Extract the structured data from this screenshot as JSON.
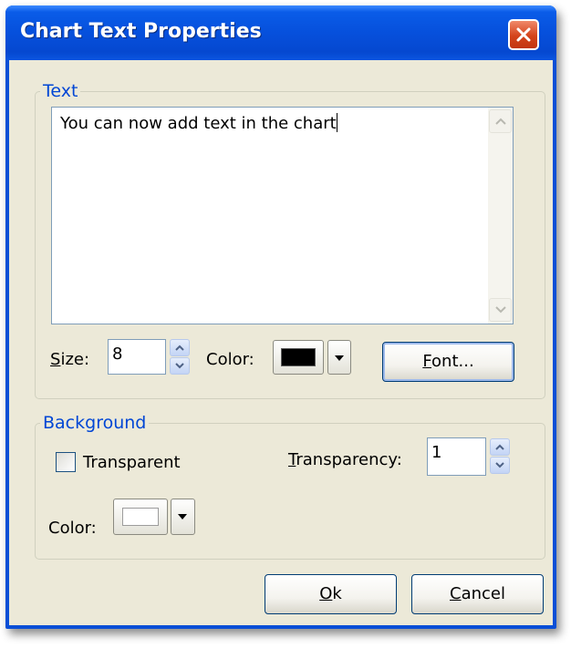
{
  "window": {
    "title": "Chart Text Properties"
  },
  "text_group": {
    "legend": "Text",
    "content": "You can now add text in the chart",
    "size_label_mnemonic": "S",
    "size_label_rest": "ize:",
    "size_value": "8",
    "color_label": "Color:",
    "color_value": "#000000",
    "font_button_mnemonic": "F",
    "font_button_rest": "ont..."
  },
  "background_group": {
    "legend": "Background",
    "transparent_label": "Transparent",
    "transparent_checked": false,
    "transparency_label_mnemonic": "T",
    "transparency_label_rest": "ransparency:",
    "transparency_value": "1",
    "color_label": "Color:",
    "color_value": "#ffffff"
  },
  "buttons": {
    "ok_mnemonic": "O",
    "ok_rest": "k",
    "cancel_mnemonic": "C",
    "cancel_rest": "ancel"
  }
}
